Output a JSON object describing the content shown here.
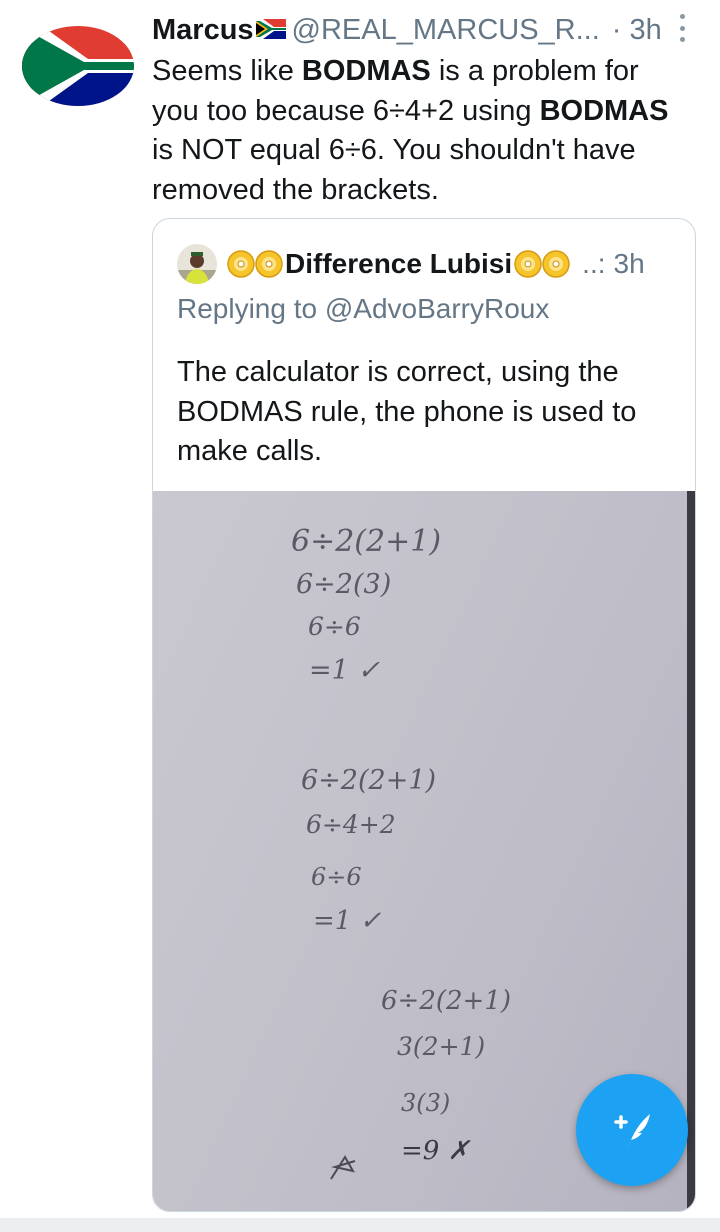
{
  "tweet": {
    "author_name": "Marcus",
    "handle": "@REAL_MARCUS_R...",
    "time": "· 3h",
    "text_segments": [
      {
        "t": "Seems like ",
        "b": false
      },
      {
        "t": "BODMAS",
        "b": true
      },
      {
        "t": " is a problem for you too because 6÷4+2 using ",
        "b": false
      },
      {
        "t": "BODMAS",
        "b": true
      },
      {
        "t": " is NOT equal 6÷6. You shouldn't have removed the brackets.",
        "b": false
      }
    ]
  },
  "quoted": {
    "author_name": "Difference Lubisi",
    "handle": "..:",
    "time": "3h",
    "replying_to": "Replying to @AdvoBarryRoux",
    "text": "The calculator is correct, using the BODMAS rule, the phone is used to make calls.",
    "photo_lines": [
      "6÷2(2+1)",
      "6÷2(3)",
      "6÷6",
      "=1 ✓",
      "6÷2(2+1)",
      "6÷4+2",
      "6÷6",
      "=1 ✓",
      "6÷2(2+1)",
      "3(2+1)",
      "3(3)",
      "=9 ✗"
    ]
  },
  "icons": {
    "avatar": "south-africa-flag-icon",
    "flag": "south-africa-flag-icon",
    "more": "more-vertical-icon",
    "emoji": "dvd-icon",
    "fab": "compose-tweet-icon"
  },
  "colors": {
    "accent": "#1da1f2",
    "secondary_text": "#657786",
    "border": "#ccd6dd"
  }
}
